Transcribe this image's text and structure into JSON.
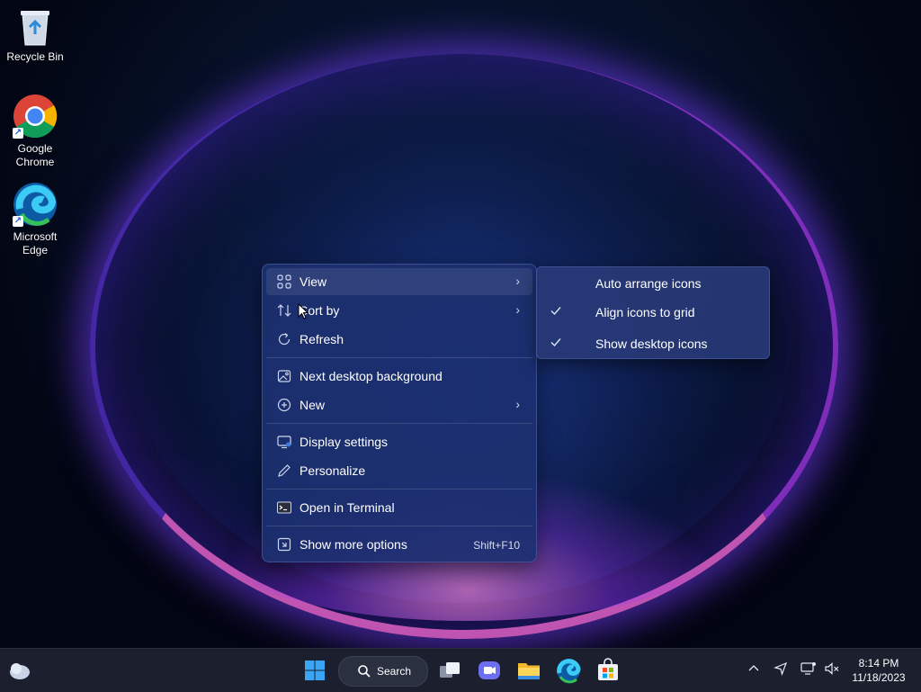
{
  "desktop": {
    "icons": [
      {
        "label": "Recycle Bin"
      },
      {
        "label_line1": "Google",
        "label_line2": "Chrome"
      },
      {
        "label_line1": "Microsoft",
        "label_line2": "Edge"
      }
    ]
  },
  "context_menu": {
    "items": [
      {
        "label": "View",
        "icon": "grid-icon",
        "has_submenu": true
      },
      {
        "label": "Sort by",
        "icon": "sort-icon",
        "has_submenu": true
      },
      {
        "label": "Refresh",
        "icon": "refresh-icon"
      },
      {
        "label": "Next desktop background",
        "icon": "image-icon"
      },
      {
        "label": "New",
        "icon": "plus-circle-icon",
        "has_submenu": true
      },
      {
        "label": "Display settings",
        "icon": "display-icon"
      },
      {
        "label": "Personalize",
        "icon": "pen-icon"
      },
      {
        "label": "Open in Terminal",
        "icon": "terminal-icon"
      },
      {
        "label": "Show more options",
        "icon": "more-options-icon",
        "shortcut": "Shift+F10"
      }
    ]
  },
  "view_submenu": {
    "items": [
      {
        "label": "Auto arrange icons",
        "checked": false
      },
      {
        "label": "Align icons to grid",
        "checked": true
      },
      {
        "label": "Show desktop icons",
        "checked": true
      }
    ]
  },
  "taskbar": {
    "search_label": "Search",
    "apps": [
      "start-icon",
      "task-view-icon",
      "chat-icon",
      "file-explorer-icon",
      "edge-icon",
      "store-icon"
    ],
    "tray_icons": [
      "chevron-up-icon",
      "location-icon",
      "network-icon",
      "volume-muted-icon"
    ],
    "clock": {
      "time": "8:14 PM",
      "date": "11/18/2023"
    }
  },
  "colors": {
    "menu_bg": "#1c3070",
    "accent": "#3b7be8",
    "taskbar_bg": "#1b1f2e"
  }
}
